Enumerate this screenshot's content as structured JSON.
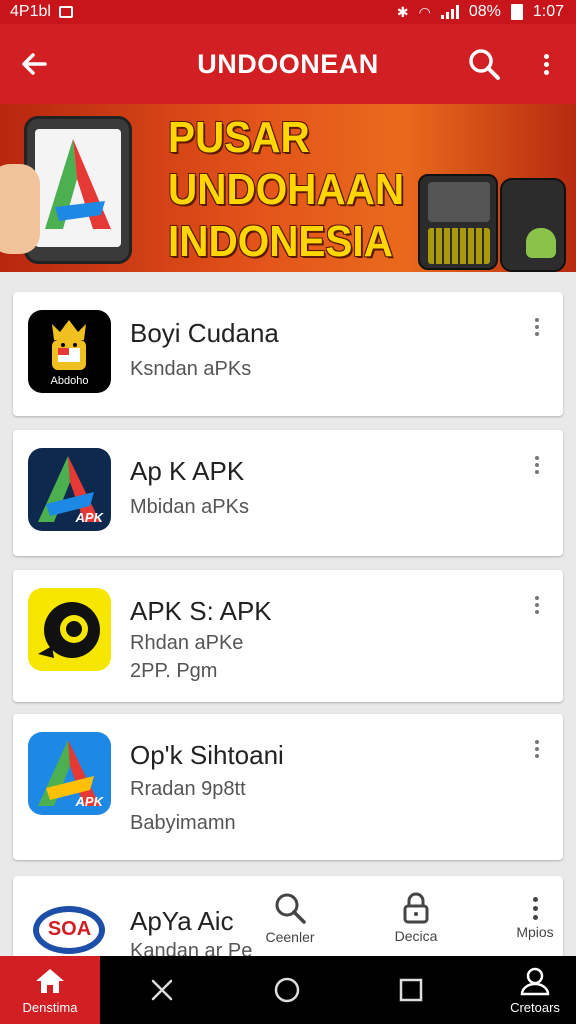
{
  "status_bar": {
    "left_text": "4P1bl",
    "battery_text": "08%",
    "time": "1:07"
  },
  "app_bar": {
    "title": "UNDOONEAN",
    "icons": [
      "back-arrow-icon",
      "search-icon",
      "more-vert-icon"
    ]
  },
  "banner": {
    "line1": "PUSAR UNDOHAAN",
    "line2": "INDONESIA"
  },
  "apps": [
    {
      "name": "Boyi Cudana",
      "lines": [
        "Ksndan aPKs"
      ],
      "icon": "android-king-icon",
      "icon_text": "Abdoho",
      "icon_bg": "#000000"
    },
    {
      "name": "Ap K APK",
      "lines": [
        "Mbidan aPKs"
      ],
      "icon": "apk-a-logo-icon",
      "icon_text": "APK",
      "icon_bg": "#0d2a4e"
    },
    {
      "name": "APK S: APK",
      "lines": [
        "Rhdan aPKe",
        "2PP. Pgm"
      ],
      "icon": "camera-lens-icon",
      "icon_text": "",
      "icon_bg": "#f7e600"
    },
    {
      "name": "Op'k Sihtoani",
      "lines": [
        "Rradan 9p8tt",
        "Babyimamn"
      ],
      "icon": "apk-a-logo-blue-icon",
      "icon_text": "APK",
      "icon_bg": "#1e88e5"
    },
    {
      "name": "ApYa Aic",
      "lines": [
        "Kandan ar Pe"
      ],
      "icon": "soa-badge-icon",
      "icon_text": "SOA",
      "icon_bg": "#ffffff"
    }
  ],
  "bottom_tabs": [
    {
      "label": "Ceenler",
      "icon": "search-icon"
    },
    {
      "label": "Decica",
      "icon": "lock-icon"
    },
    {
      "label": "Mpios",
      "icon": "more-vert-icon"
    }
  ],
  "nav_bar": {
    "home_label": "Denstima",
    "account_label": "Cretoars",
    "buttons": [
      "home-icon",
      "close-x-icon",
      "circle-home-icon",
      "square-recents-icon",
      "account-icon"
    ]
  },
  "colors": {
    "primary": "#d11f24",
    "status_bar": "#c8151b",
    "banner_text": "#ffd600"
  }
}
